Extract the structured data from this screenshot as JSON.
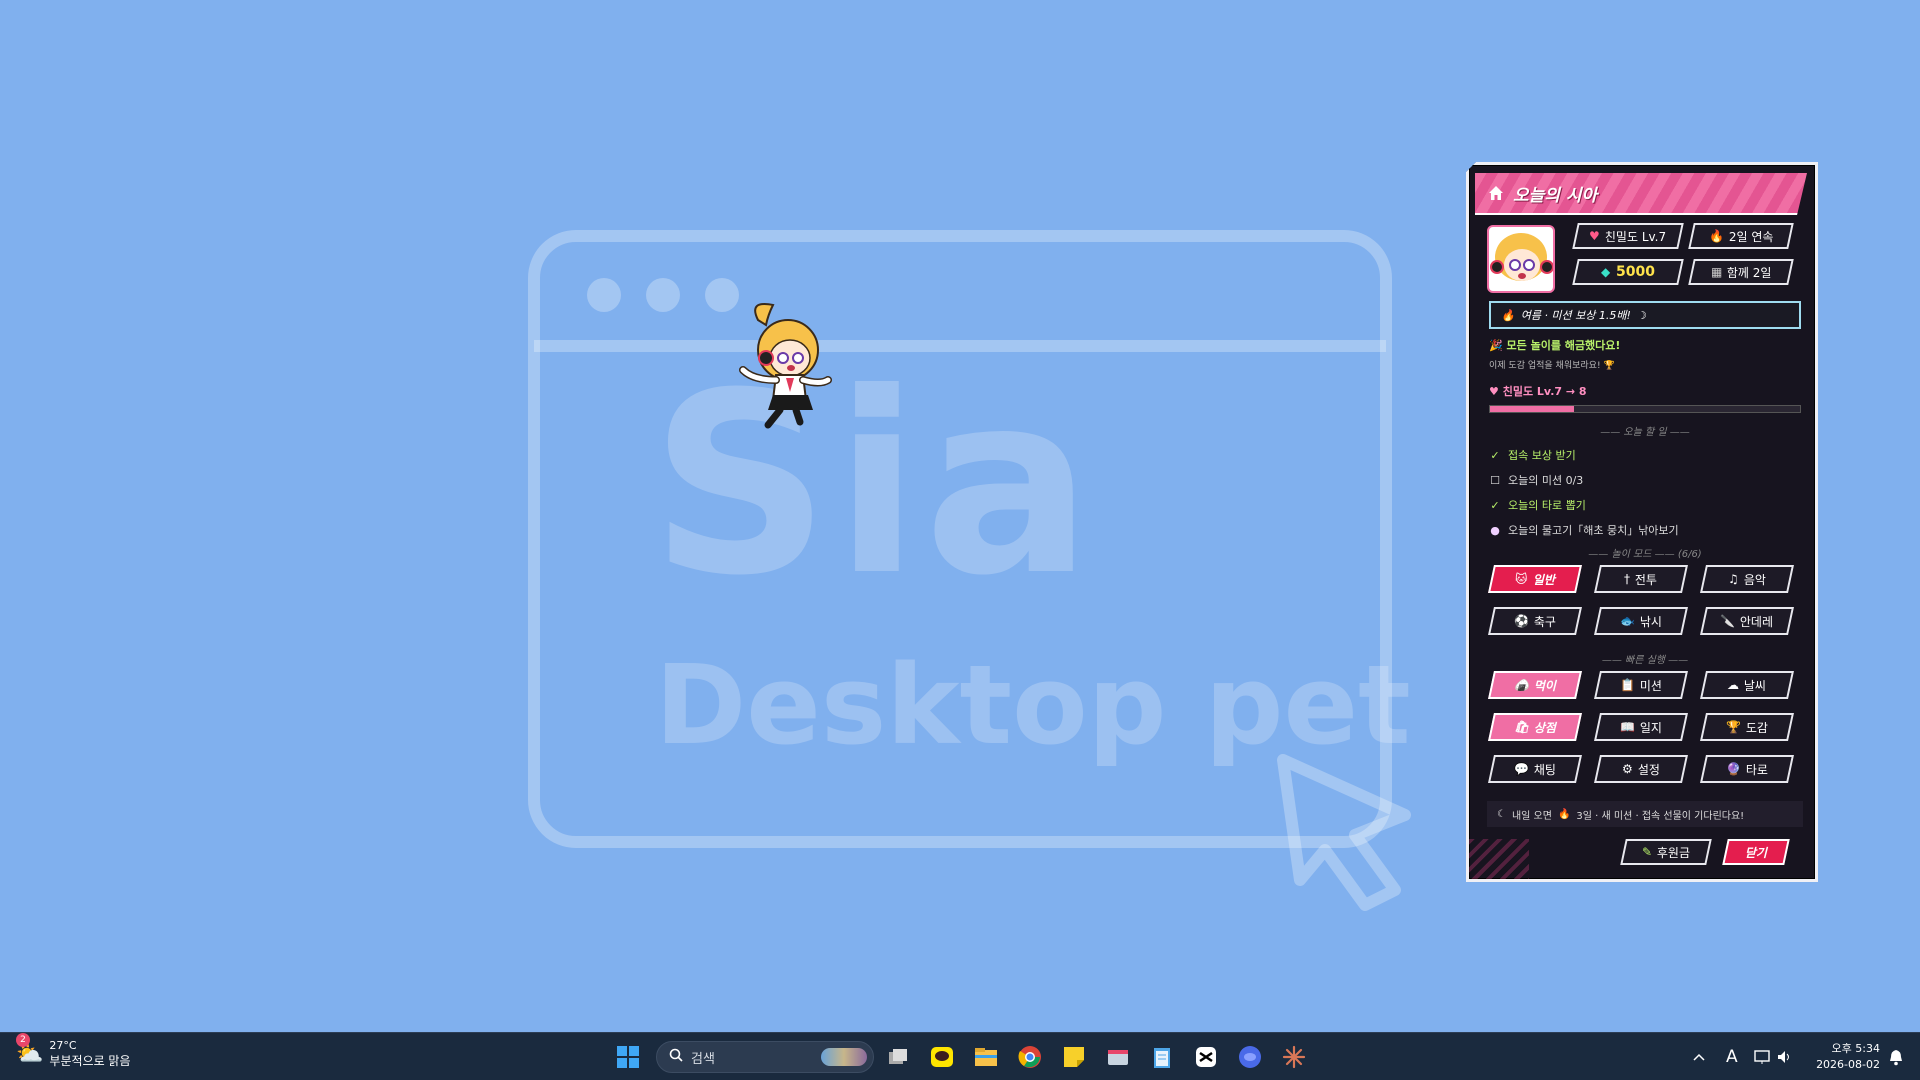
{
  "wallpaper": {
    "title_large": "Sia",
    "title_sub": "Desktop pet"
  },
  "panel": {
    "title": "오늘의 시아",
    "stats": {
      "affinity": "친밀도 Lv.7",
      "streak": "2일 연속",
      "gems": "5000",
      "together": "함께 2일"
    },
    "event_banner": "여름 · 미션 보상 1.5배!",
    "unlock_message": "모든 놀이를 해금했다요!",
    "unlock_sub": "이제 도감 업적을 채워보라요!",
    "affinity_progress_label": "친밀도 Lv.7 → 8",
    "affinity_progress": 0.27,
    "todo_header": "오늘 할 일",
    "todos": [
      {
        "label": "접속 보상 받기",
        "done": true
      },
      {
        "label": "오늘의 미션 0/3",
        "done": false
      },
      {
        "label": "오늘의 타로 뽑기",
        "done": true
      },
      {
        "label": "오늘의 물고기「해초 뭉치」낚아보기",
        "done": false
      }
    ],
    "mode_header": "놀이 모드",
    "mode_count": "(6/6)",
    "modes": [
      {
        "label": "일반",
        "icon": "cat-icon",
        "active": true
      },
      {
        "label": "전투",
        "icon": "sword-icon",
        "active": false
      },
      {
        "label": "음악",
        "icon": "music-icon",
        "active": false
      },
      {
        "label": "축구",
        "icon": "soccer-ball-icon",
        "active": false
      },
      {
        "label": "낚시",
        "icon": "fish-icon",
        "active": false
      },
      {
        "label": "안데레",
        "icon": "knife-icon",
        "active": false
      }
    ],
    "quick_header": "빠른 실행",
    "quick_actions": [
      {
        "label": "먹이",
        "icon": "food-bowl-icon",
        "highlight": true
      },
      {
        "label": "미션",
        "icon": "clipboard-icon",
        "highlight": false
      },
      {
        "label": "날씨",
        "icon": "cloud-icon",
        "highlight": false
      },
      {
        "label": "상점",
        "icon": "shopping-bag-icon",
        "highlight": true
      },
      {
        "label": "일지",
        "icon": "book-icon",
        "highlight": false
      },
      {
        "label": "도감",
        "icon": "trophy-icon",
        "highlight": false
      },
      {
        "label": "채팅",
        "icon": "chat-icon",
        "highlight": false
      },
      {
        "label": "설정",
        "icon": "gear-icon",
        "highlight": false
      },
      {
        "label": "타로",
        "icon": "crystal-ball-icon",
        "highlight": false
      }
    ],
    "footer_note_a": "내일 오면",
    "footer_note_b": "3일 · 새 미션 · 접속 선물이 기다린다요!",
    "donate_label": "후원금",
    "close_label": "닫기"
  },
  "taskbar": {
    "weather_badge": "2",
    "weather_temp": "27°C",
    "weather_desc": "부분적으로 맑음",
    "search_placeholder": "검색",
    "clock_time": "오후 5:34",
    "clock_date": "2026-08-02",
    "lang_indicator": "A"
  },
  "colors": {
    "accent_pink": "#f06ea4",
    "accent_red": "#e41e4e",
    "panel_bg": "#17141f",
    "desktop_bg": "#80b0ee"
  }
}
